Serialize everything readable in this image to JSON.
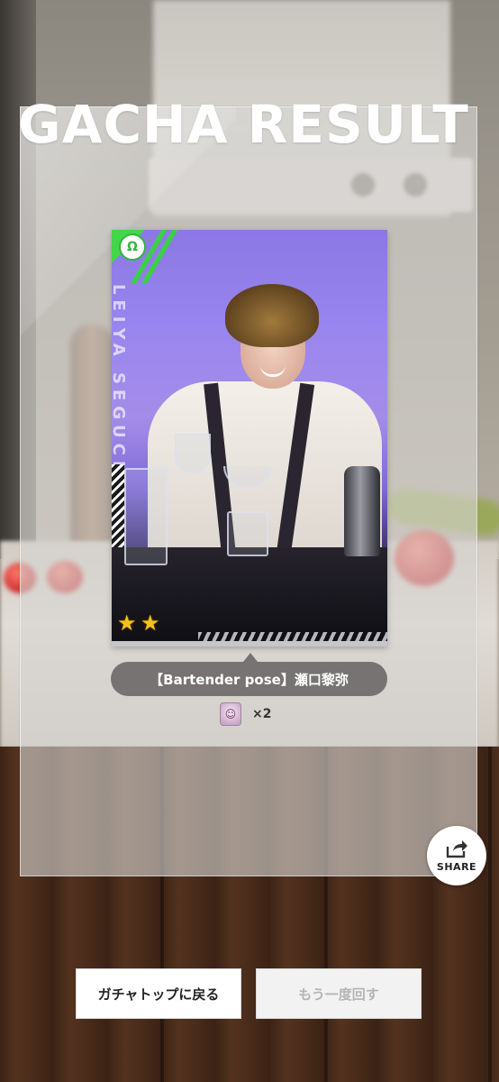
{
  "header": {
    "title": "GACHA RESULT"
  },
  "card": {
    "vertical_name": "LEIYA SEGUCHI",
    "badge_symbol": "Ω",
    "stars": 2,
    "star_glyph": "★",
    "attribute_color": "#3ad144"
  },
  "result": {
    "card_title": "【Bartender pose】瀬口黎弥",
    "item_icon": "fan-item-icon",
    "item_count": "×2"
  },
  "share": {
    "label": "SHARE",
    "icon": "share-icon"
  },
  "actions": {
    "back_label": "ガチャトップに戻る",
    "retry_label": "もう一度回す"
  },
  "colors": {
    "pill_bg": "#777372",
    "panel_bg": "rgba(215,213,210,0.62)",
    "star": "#f2c21b"
  }
}
